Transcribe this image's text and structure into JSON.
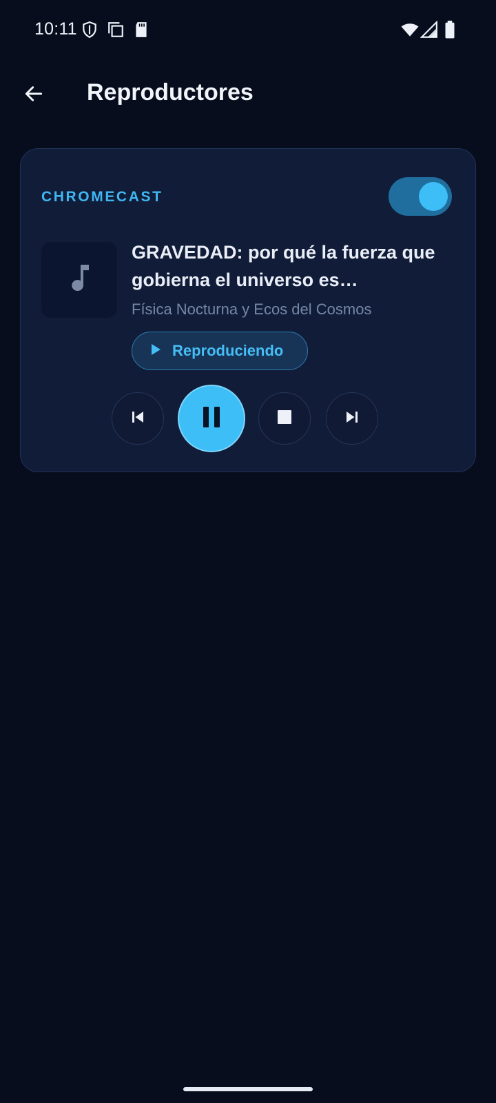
{
  "status_bar": {
    "time": "10:11",
    "left_icons": [
      "shield-icon",
      "copy-icon",
      "sd-card-icon"
    ],
    "right_icons": [
      "wifi-icon",
      "cellular-signal-icon",
      "battery-icon"
    ]
  },
  "app_bar": {
    "back_icon": "arrow-left-icon",
    "title": "Reproductores"
  },
  "player": {
    "label": "CHROMECAST",
    "enabled": true,
    "track_title": "GRAVEDAD: por qué la fuerza que gobierna el universo es sorprendentemente débil",
    "artist": "Física Nocturna y Ecos del Cosmos",
    "state_label": "Reproduciendo",
    "controls": [
      "skip-previous-icon",
      "pause-icon",
      "stop-icon",
      "skip-next-icon"
    ]
  },
  "colors": {
    "background": "#070d1c",
    "card": "#111c38",
    "accent": "#3dbef6",
    "muted_text": "#7588a8"
  }
}
